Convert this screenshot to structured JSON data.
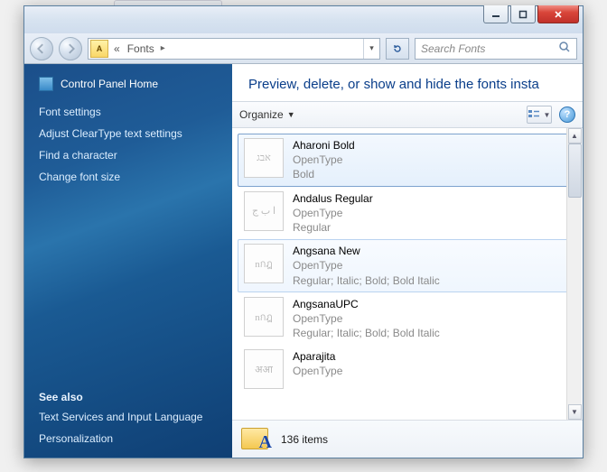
{
  "titlebar": {
    "minimize_tip": "Minimize",
    "maximize_tip": "Maximize",
    "close_tip": "Close"
  },
  "nav": {
    "back_tip": "Back",
    "forward_tip": "Forward",
    "crumb_prefix": "«",
    "crumb_label": "Fonts",
    "refresh_tip": "Refresh",
    "search_placeholder": "Search Fonts"
  },
  "sidebar": {
    "home": "Control Panel Home",
    "links": [
      "Font settings",
      "Adjust ClearType text settings",
      "Find a character",
      "Change font size"
    ],
    "see_also_heading": "See also",
    "see_also": [
      "Text Services and Input Language",
      "Personalization"
    ]
  },
  "content": {
    "heading": "Preview, delete, or show and hide the fonts insta",
    "organize_label": "Organize",
    "view_tip": "Change your view",
    "help_tip": "Get help"
  },
  "fonts": [
    {
      "name": "Aharoni Bold",
      "type": "OpenType",
      "style": "Bold",
      "preview": "אבג",
      "state": "selected"
    },
    {
      "name": "Andalus Regular",
      "type": "OpenType",
      "style": "Regular",
      "preview": "ا ب ج",
      "state": ""
    },
    {
      "name": "Angsana New",
      "type": "OpenType",
      "style": "Regular; Italic; Bold; Bold Italic",
      "preview": "nกฎ",
      "state": "hover"
    },
    {
      "name": "AngsanaUPC",
      "type": "OpenType",
      "style": "Regular; Italic; Bold; Bold Italic",
      "preview": "nกฎ",
      "state": ""
    },
    {
      "name": "Aparajita",
      "type": "OpenType",
      "style": "",
      "preview": "अआ",
      "state": ""
    }
  ],
  "status": {
    "count_label": "136 items"
  }
}
